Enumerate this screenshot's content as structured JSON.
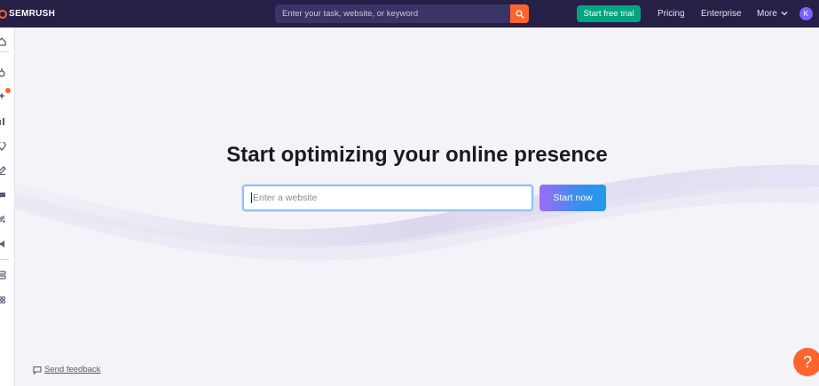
{
  "brand": {
    "name": "SEMRUSH"
  },
  "topbar": {
    "search_placeholder": "Enter your task, website, or keyword",
    "trial_label": "Start free trial",
    "nav": [
      "Pricing",
      "Enterprise",
      "More"
    ],
    "avatar_initial": "K"
  },
  "sidebar": {
    "icons": [
      "home-icon",
      "link-icon",
      "sparkle-icon",
      "bar-chart-icon",
      "location-pin-icon",
      "pencil-icon",
      "chat-icon",
      "broadcast-icon",
      "megaphone-icon",
      "app-stack-icon",
      "apps-icon"
    ]
  },
  "main": {
    "headline": "Start optimizing your online presence",
    "input_placeholder": "Enter a website",
    "cta_label": "Start now"
  },
  "footer": {
    "feedback_label": "Send feedback",
    "help_label": "?"
  },
  "colors": {
    "topbar": "#261f46",
    "accent": "#ff642d",
    "trial": "#00a67e",
    "cta_start": "#9e6cf4",
    "cta_end": "#1f9bea"
  }
}
